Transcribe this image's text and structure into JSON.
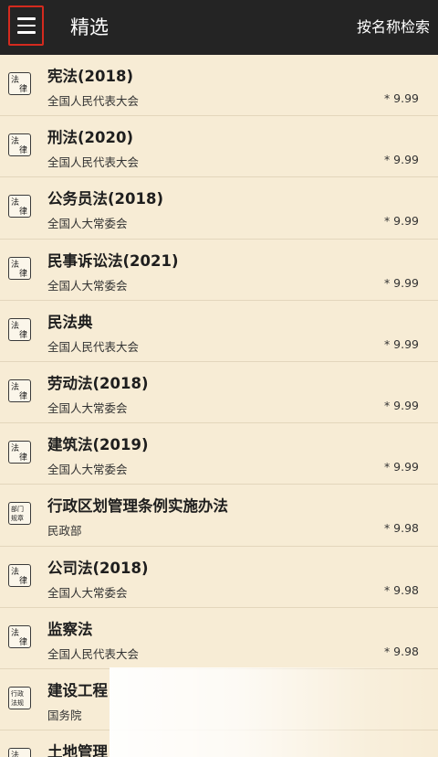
{
  "topbar": {
    "title": "精选",
    "search_label": "按名称检索"
  },
  "items": [
    {
      "title": "宪法(2018)",
      "issuer": "全国人民代表大会",
      "price": "* 9.99",
      "seal": "law"
    },
    {
      "title": "刑法(2020)",
      "issuer": "全国人民代表大会",
      "price": "* 9.99",
      "seal": "law"
    },
    {
      "title": "公务员法(2018)",
      "issuer": "全国人大常委会",
      "price": "* 9.99",
      "seal": "law"
    },
    {
      "title": "民事诉讼法(2021)",
      "issuer": "全国人大常委会",
      "price": "* 9.99",
      "seal": "law"
    },
    {
      "title": "民法典",
      "issuer": "全国人民代表大会",
      "price": "* 9.99",
      "seal": "law"
    },
    {
      "title": "劳动法(2018)",
      "issuer": "全国人大常委会",
      "price": "* 9.99",
      "seal": "law"
    },
    {
      "title": "建筑法(2019)",
      "issuer": "全国人大常委会",
      "price": "* 9.99",
      "seal": "law"
    },
    {
      "title": "行政区划管理条例实施办法",
      "issuer": "民政部",
      "price": "* 9.98",
      "seal": "dept"
    },
    {
      "title": "公司法(2018)",
      "issuer": "全国人大常委会",
      "price": "* 9.98",
      "seal": "law"
    },
    {
      "title": "监察法",
      "issuer": "全国人民代表大会",
      "price": "* 9.98",
      "seal": "law"
    },
    {
      "title": "建设工程",
      "issuer": "国务院",
      "price": "",
      "seal": "admin"
    },
    {
      "title": "土地管理",
      "issuer": "",
      "price": "",
      "seal": "law"
    }
  ],
  "seals": {
    "law": [
      "法",
      "律"
    ],
    "dept": [
      "部门",
      "规章"
    ],
    "admin": [
      "行政",
      "法规"
    ]
  }
}
